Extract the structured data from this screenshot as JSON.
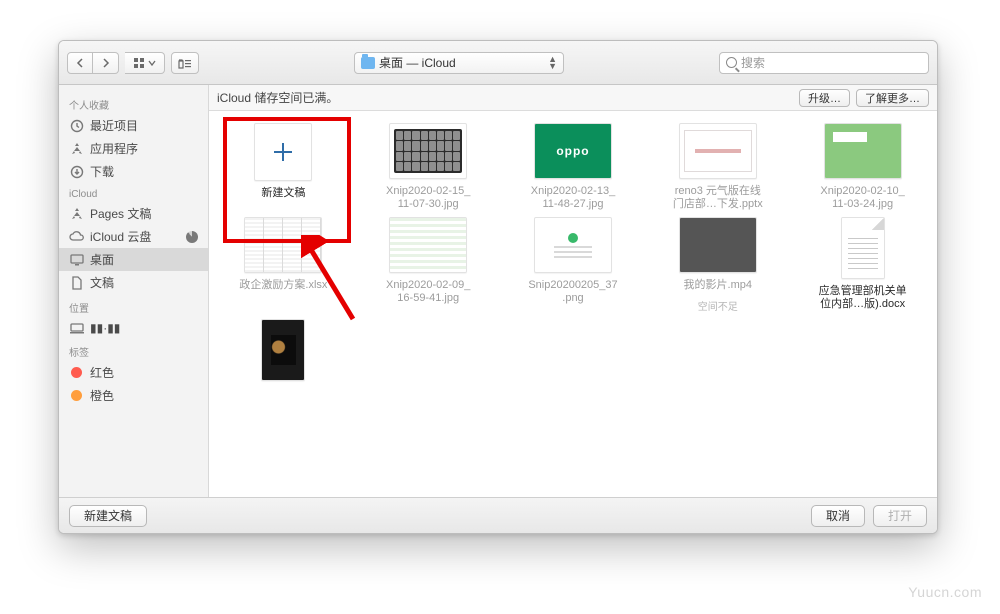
{
  "toolbar": {
    "path_label": "桌面 — iCloud",
    "search_placeholder": "搜索"
  },
  "sidebar": {
    "sections": [
      {
        "header": "个人收藏",
        "items": [
          {
            "icon": "recents",
            "label": "最近项目"
          },
          {
            "icon": "apps",
            "label": "应用程序"
          },
          {
            "icon": "downloads",
            "label": "下载"
          }
        ]
      },
      {
        "header": "iCloud",
        "items": [
          {
            "icon": "apps",
            "label": "Pages 文稿"
          },
          {
            "icon": "cloud",
            "label": "iCloud 云盘",
            "trailing": "pie"
          },
          {
            "icon": "desktop",
            "label": "桌面",
            "selected": true
          },
          {
            "icon": "doc",
            "label": "文稿"
          }
        ]
      },
      {
        "header": "位置",
        "items": [
          {
            "icon": "computer",
            "label": "▮▮·▮▮"
          }
        ]
      },
      {
        "header": "标签",
        "items": [
          {
            "icon": "tag",
            "color": "#ff5b4e",
            "label": "红色"
          },
          {
            "icon": "tag",
            "color": "#ff9e3d",
            "label": "橙色"
          }
        ]
      }
    ]
  },
  "notice": {
    "text": "iCloud 储存空间已满。",
    "upgrade": "升级…",
    "learn_more": "了解更多…"
  },
  "files": [
    {
      "kind": "new",
      "label": "新建文稿",
      "dark": true
    },
    {
      "kind": "apps",
      "label": "Xnip2020-02-15_\n11-07-30.jpg"
    },
    {
      "kind": "oppo",
      "label": "Xnip2020-02-13_\n11-48-27.jpg"
    },
    {
      "kind": "slide",
      "label": "reno3 元气版在线\n门店部…下发.pptx"
    },
    {
      "kind": "green",
      "label": "Xnip2020-02-10_\n11-03-24.jpg"
    },
    {
      "kind": "xcel",
      "label": "政企激励方案.xlsx"
    },
    {
      "kind": "sheet",
      "label": "Xnip2020-02-09_\n16-59-41.jpg"
    },
    {
      "kind": "login",
      "label": "Snip20200205_37\n.png"
    },
    {
      "kind": "video",
      "label": "我的影片.mp4",
      "sub": "空间不足"
    },
    {
      "kind": "doc",
      "label": "应急管理部机关单\n位内部…版).docx",
      "dark": true
    },
    {
      "kind": "dark",
      "label": "",
      "tall": true
    }
  ],
  "bottom": {
    "new_doc": "新建文稿",
    "cancel": "取消",
    "open": "打开"
  },
  "watermark": "Yuucn.com"
}
